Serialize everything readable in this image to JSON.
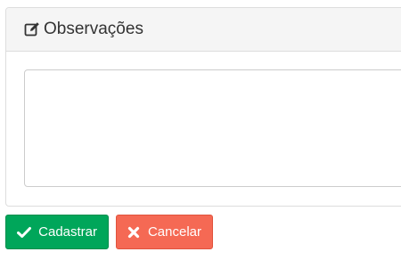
{
  "panel": {
    "title": "Observações",
    "title_icon": "edit-icon"
  },
  "observacoes": {
    "value": "",
    "placeholder": ""
  },
  "buttons": {
    "save_label": "Cadastrar",
    "save_icon": "check-icon",
    "cancel_label": "Cancelar",
    "cancel_icon": "times-icon"
  },
  "colors": {
    "success": "#00a65a",
    "danger": "#f56954",
    "panel_heading_bg": "#f5f5f5",
    "border": "#dddddd"
  }
}
